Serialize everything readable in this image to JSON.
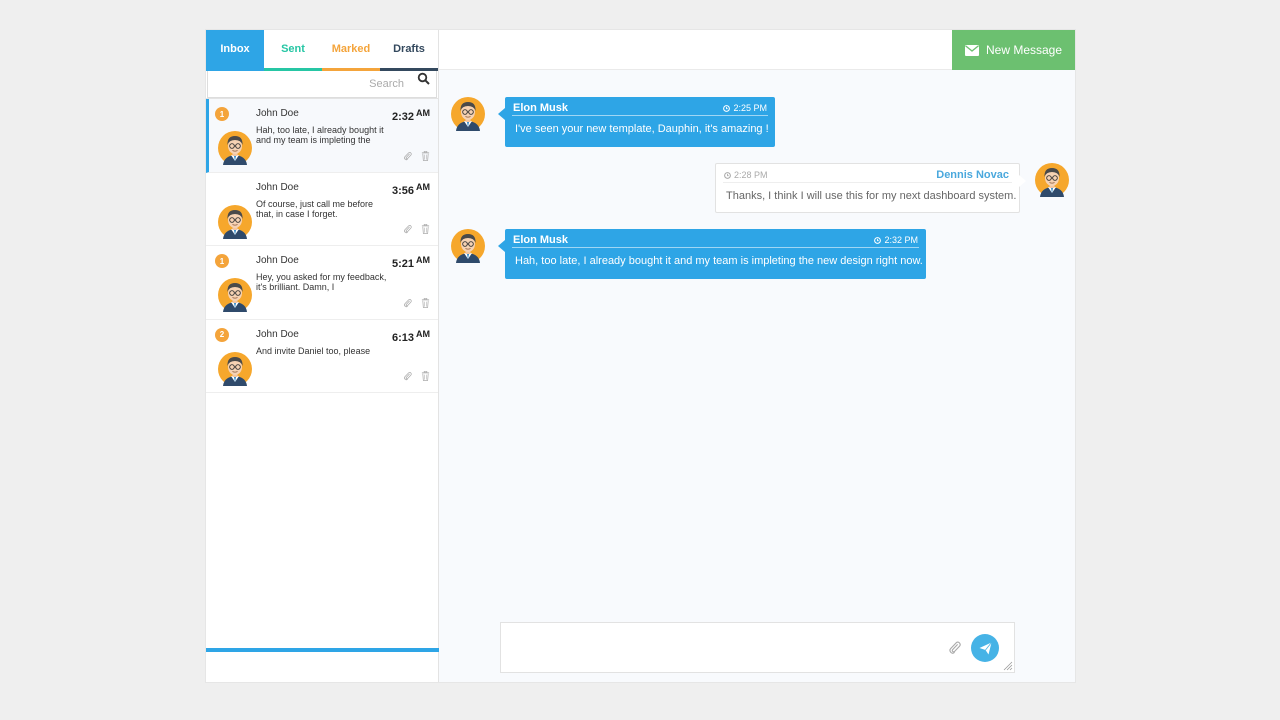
{
  "tabs": [
    {
      "label": "Inbox"
    },
    {
      "label": "Sent"
    },
    {
      "label": "Marked"
    },
    {
      "label": "Drafts"
    }
  ],
  "search": {
    "placeholder": "Search"
  },
  "messages": [
    {
      "badge": "1",
      "name": "John Doe",
      "time": "2:32",
      "ampm": "AM",
      "text": "Hah, too late, I already bought it and my team is impleting the"
    },
    {
      "badge": "",
      "name": "John Doe",
      "time": "3:56",
      "ampm": "AM",
      "text": "Of course, just call me before that, in case I forget."
    },
    {
      "badge": "1",
      "name": "John Doe",
      "time": "5:21",
      "ampm": "AM",
      "text": "Hey, you asked for my feedback, it's brilliant. Damn, I"
    },
    {
      "badge": "2",
      "name": "John Doe",
      "time": "6:13",
      "ampm": "AM",
      "text": "And invite Daniel too, please"
    }
  ],
  "header": {
    "new_message_label": "New Message"
  },
  "chat": [
    {
      "direction": "in",
      "name": "Elon Musk",
      "time": "2:25 PM",
      "text": "I've seen your new template, Dauphin, it's amazing !"
    },
    {
      "direction": "out",
      "name": "Dennis Novac",
      "time": "2:28 PM",
      "text": "Thanks, I think I will use this for my next dashboard system."
    },
    {
      "direction": "in",
      "name": "Elon Musk",
      "time": "2:32 PM",
      "text": "Hah, too late, I already bought it and my team is impleting the new design right now."
    }
  ],
  "composer": {
    "placeholder": ""
  },
  "colors": {
    "inbox": "#2ea5e6",
    "sent": "#26c6a4",
    "marked": "#f4a43b",
    "drafts": "#34495e",
    "new_message": "#6cc070",
    "badge": "#f4a43b"
  },
  "icons": {
    "search": "search-icon",
    "envelope": "envelope-icon",
    "paperclip": "paperclip-icon",
    "trash": "trash-icon",
    "clock": "clock-icon",
    "send": "send-icon"
  }
}
